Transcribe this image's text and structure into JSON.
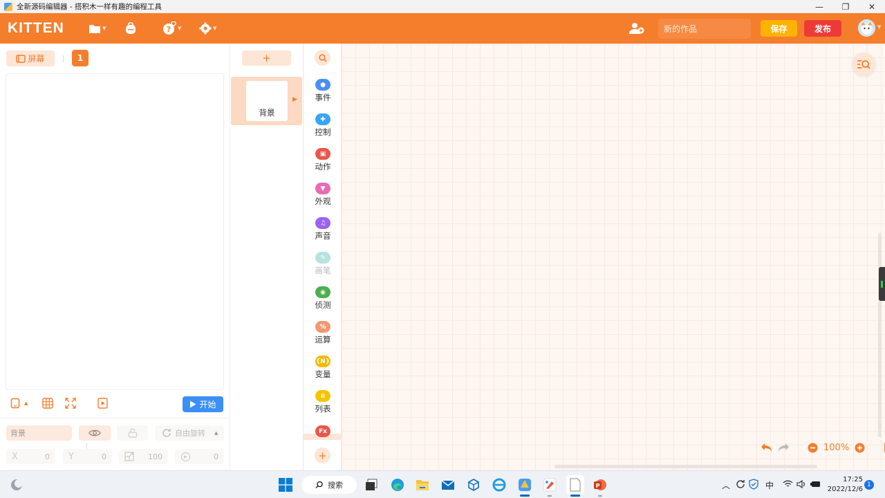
{
  "window": {
    "title": "全新源码编辑器 - 搭积木一样有趣的编程工具",
    "minimize": "—",
    "restore": "❐",
    "close": "✕"
  },
  "header": {
    "logo": "KITTEN",
    "work_placeholder": "新的作品",
    "save_label": "保存",
    "publish_label": "发布"
  },
  "stage": {
    "screen_label": "屏幕",
    "scene_number": "1",
    "start_label": "开始",
    "object_name": "背景",
    "rotation_label": "自由旋转",
    "x_label": "X",
    "x_value": "0",
    "y_label": "Y",
    "y_value": "0",
    "size_value": "100",
    "direction_value": "0"
  },
  "sprites": {
    "add_label": "+",
    "background_label": "背景"
  },
  "categories": [
    {
      "label": "事件",
      "color": "#4a8ff5",
      "icon": "event-icon",
      "glyph": "●"
    },
    {
      "label": "控制",
      "color": "#3aa4f5",
      "icon": "control-icon",
      "glyph": "✚"
    },
    {
      "label": "动作",
      "color": "#e9574c",
      "icon": "action-icon",
      "glyph": "▣"
    },
    {
      "label": "外观",
      "color": "#e86bb5",
      "icon": "appearance-icon",
      "glyph": "▼"
    },
    {
      "label": "声音",
      "color": "#9a64f0",
      "icon": "sound-icon",
      "glyph": "♫"
    },
    {
      "label": "画笔",
      "color": "#b7e3df",
      "icon": "pen-icon",
      "glyph": "✎"
    },
    {
      "label": "侦测",
      "color": "#4caf50",
      "icon": "detect-icon",
      "glyph": "◉"
    },
    {
      "label": "运算",
      "color": "#ee9972",
      "icon": "operator-icon",
      "glyph": "%"
    },
    {
      "label": "变量",
      "color": "#f5b800",
      "icon": "variable-icon",
      "glyph": "{N}"
    },
    {
      "label": "列表",
      "color": "#f5c400",
      "icon": "list-icon",
      "glyph": "≡"
    }
  ],
  "category_more": "Fx",
  "workspace": {
    "zoom": "100%"
  },
  "taskbar": {
    "search_label": "搜索",
    "ime_label": "中",
    "time": "17:25",
    "date": "2022/12/6",
    "notification_count": "1"
  }
}
